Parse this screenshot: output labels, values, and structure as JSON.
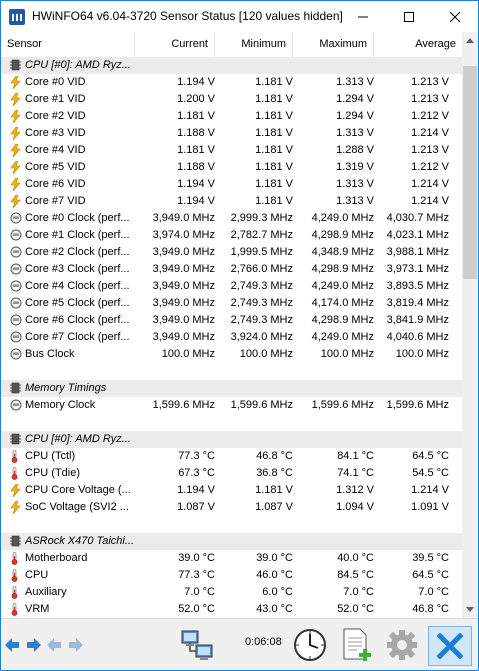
{
  "window": {
    "title": "HWiNFO64 v6.04-3720 Sensor Status [120 values hidden]"
  },
  "columns": {
    "sensor": "Sensor",
    "current": "Current",
    "minimum": "Minimum",
    "maximum": "Maximum",
    "average": "Average"
  },
  "rows": [
    {
      "type": "group",
      "icon": "chip-icon",
      "name": "CPU [#0]: AMD Ryz..."
    },
    {
      "type": "data",
      "icon": "voltage-icon",
      "name": "Core #0 VID",
      "current": "1.194 V",
      "min": "1.181 V",
      "max": "1.313 V",
      "avg": "1.213 V"
    },
    {
      "type": "data",
      "icon": "voltage-icon",
      "name": "Core #1 VID",
      "current": "1.200 V",
      "min": "1.181 V",
      "max": "1.294 V",
      "avg": "1.213 V"
    },
    {
      "type": "data",
      "icon": "voltage-icon",
      "name": "Core #2 VID",
      "current": "1.181 V",
      "min": "1.181 V",
      "max": "1.294 V",
      "avg": "1.212 V"
    },
    {
      "type": "data",
      "icon": "voltage-icon",
      "name": "Core #3 VID",
      "current": "1.188 V",
      "min": "1.181 V",
      "max": "1.313 V",
      "avg": "1.214 V"
    },
    {
      "type": "data",
      "icon": "voltage-icon",
      "name": "Core #4 VID",
      "current": "1.181 V",
      "min": "1.181 V",
      "max": "1.288 V",
      "avg": "1.213 V"
    },
    {
      "type": "data",
      "icon": "voltage-icon",
      "name": "Core #5 VID",
      "current": "1.188 V",
      "min": "1.181 V",
      "max": "1.319 V",
      "avg": "1.212 V"
    },
    {
      "type": "data",
      "icon": "voltage-icon",
      "name": "Core #6 VID",
      "current": "1.194 V",
      "min": "1.181 V",
      "max": "1.313 V",
      "avg": "1.214 V"
    },
    {
      "type": "data",
      "icon": "voltage-icon",
      "name": "Core #7 VID",
      "current": "1.194 V",
      "min": "1.181 V",
      "max": "1.313 V",
      "avg": "1.214 V"
    },
    {
      "type": "data",
      "icon": "clock-icon",
      "name": "Core #0 Clock (perf...",
      "current": "3,949.0 MHz",
      "min": "2,999.3 MHz",
      "max": "4,249.0 MHz",
      "avg": "4,030.7 MHz"
    },
    {
      "type": "data",
      "icon": "clock-icon",
      "name": "Core #1 Clock (perf...",
      "current": "3,974.0 MHz",
      "min": "2,782.7 MHz",
      "max": "4,298.9 MHz",
      "avg": "4,023.1 MHz"
    },
    {
      "type": "data",
      "icon": "clock-icon",
      "name": "Core #2 Clock (perf...",
      "current": "3,949.0 MHz",
      "min": "1,999.5 MHz",
      "max": "4,348.9 MHz",
      "avg": "3,988.1 MHz"
    },
    {
      "type": "data",
      "icon": "clock-icon",
      "name": "Core #3 Clock (perf...",
      "current": "3,949.0 MHz",
      "min": "2,766.0 MHz",
      "max": "4,298.9 MHz",
      "avg": "3,973.1 MHz"
    },
    {
      "type": "data",
      "icon": "clock-icon",
      "name": "Core #4 Clock (perf...",
      "current": "3,949.0 MHz",
      "min": "2,749.3 MHz",
      "max": "4,249.0 MHz",
      "avg": "3,893.5 MHz"
    },
    {
      "type": "data",
      "icon": "clock-icon",
      "name": "Core #5 Clock (perf...",
      "current": "3,949.0 MHz",
      "min": "2,749.3 MHz",
      "max": "4,174.0 MHz",
      "avg": "3,819.4 MHz"
    },
    {
      "type": "data",
      "icon": "clock-icon",
      "name": "Core #6 Clock (perf...",
      "current": "3,949.0 MHz",
      "min": "2,749.3 MHz",
      "max": "4,298.9 MHz",
      "avg": "3,841.9 MHz"
    },
    {
      "type": "data",
      "icon": "clock-icon",
      "name": "Core #7 Clock (perf...",
      "current": "3,949.0 MHz",
      "min": "3,924.0 MHz",
      "max": "4,249.0 MHz",
      "avg": "4,040.6 MHz"
    },
    {
      "type": "data",
      "icon": "clock-icon",
      "name": "Bus Clock",
      "current": "100.0 MHz",
      "min": "100.0 MHz",
      "max": "100.0 MHz",
      "avg": "100.0 MHz"
    },
    {
      "type": "blank"
    },
    {
      "type": "group",
      "icon": "chip-icon",
      "name": "Memory Timings"
    },
    {
      "type": "data",
      "icon": "clock-icon",
      "name": "Memory Clock",
      "current": "1,599.6 MHz",
      "min": "1,599.6 MHz",
      "max": "1,599.6 MHz",
      "avg": "1,599.6 MHz"
    },
    {
      "type": "blank"
    },
    {
      "type": "group",
      "icon": "chip-icon",
      "name": "CPU [#0]: AMD Ryz..."
    },
    {
      "type": "data",
      "icon": "thermometer-icon",
      "name": "CPU (Tctl)",
      "current": "77.3 °C",
      "min": "46.8 °C",
      "max": "84.1 °C",
      "avg": "64.5 °C"
    },
    {
      "type": "data",
      "icon": "thermometer-icon",
      "name": "CPU (Tdie)",
      "current": "67.3 °C",
      "min": "36.8 °C",
      "max": "74.1 °C",
      "avg": "54.5 °C"
    },
    {
      "type": "data",
      "icon": "voltage-icon",
      "name": "CPU Core Voltage (...",
      "current": "1.194 V",
      "min": "1.181 V",
      "max": "1.312 V",
      "avg": "1.214 V"
    },
    {
      "type": "data",
      "icon": "voltage-icon",
      "name": "SoC Voltage (SVI2 ...",
      "current": "1.087 V",
      "min": "1.087 V",
      "max": "1.094 V",
      "avg": "1.091 V"
    },
    {
      "type": "blank"
    },
    {
      "type": "group",
      "icon": "chip-icon",
      "name": "ASRock X470 Taichi..."
    },
    {
      "type": "data",
      "icon": "thermometer-icon",
      "name": "Motherboard",
      "current": "39.0 °C",
      "min": "39.0 °C",
      "max": "40.0 °C",
      "avg": "39.5 °C"
    },
    {
      "type": "data",
      "icon": "thermometer-icon",
      "name": "CPU",
      "current": "77.3 °C",
      "min": "46.0 °C",
      "max": "84.5 °C",
      "avg": "64.5 °C"
    },
    {
      "type": "data",
      "icon": "thermometer-icon",
      "name": "Auxiliary",
      "current": "7.0 °C",
      "min": "6.0 °C",
      "max": "7.0 °C",
      "avg": "7.0 °C"
    },
    {
      "type": "data",
      "icon": "thermometer-icon",
      "name": "VRM",
      "current": "52.0 °C",
      "min": "43.0 °C",
      "max": "52.0 °C",
      "avg": "46.8 °C"
    }
  ],
  "toolbar": {
    "elapsed_time": "0:06:08"
  },
  "colors": {
    "accent": "#1883d7",
    "group_bg": "#ebebeb",
    "voltage": "#f2b500",
    "close_x": "#1a7fd6"
  }
}
